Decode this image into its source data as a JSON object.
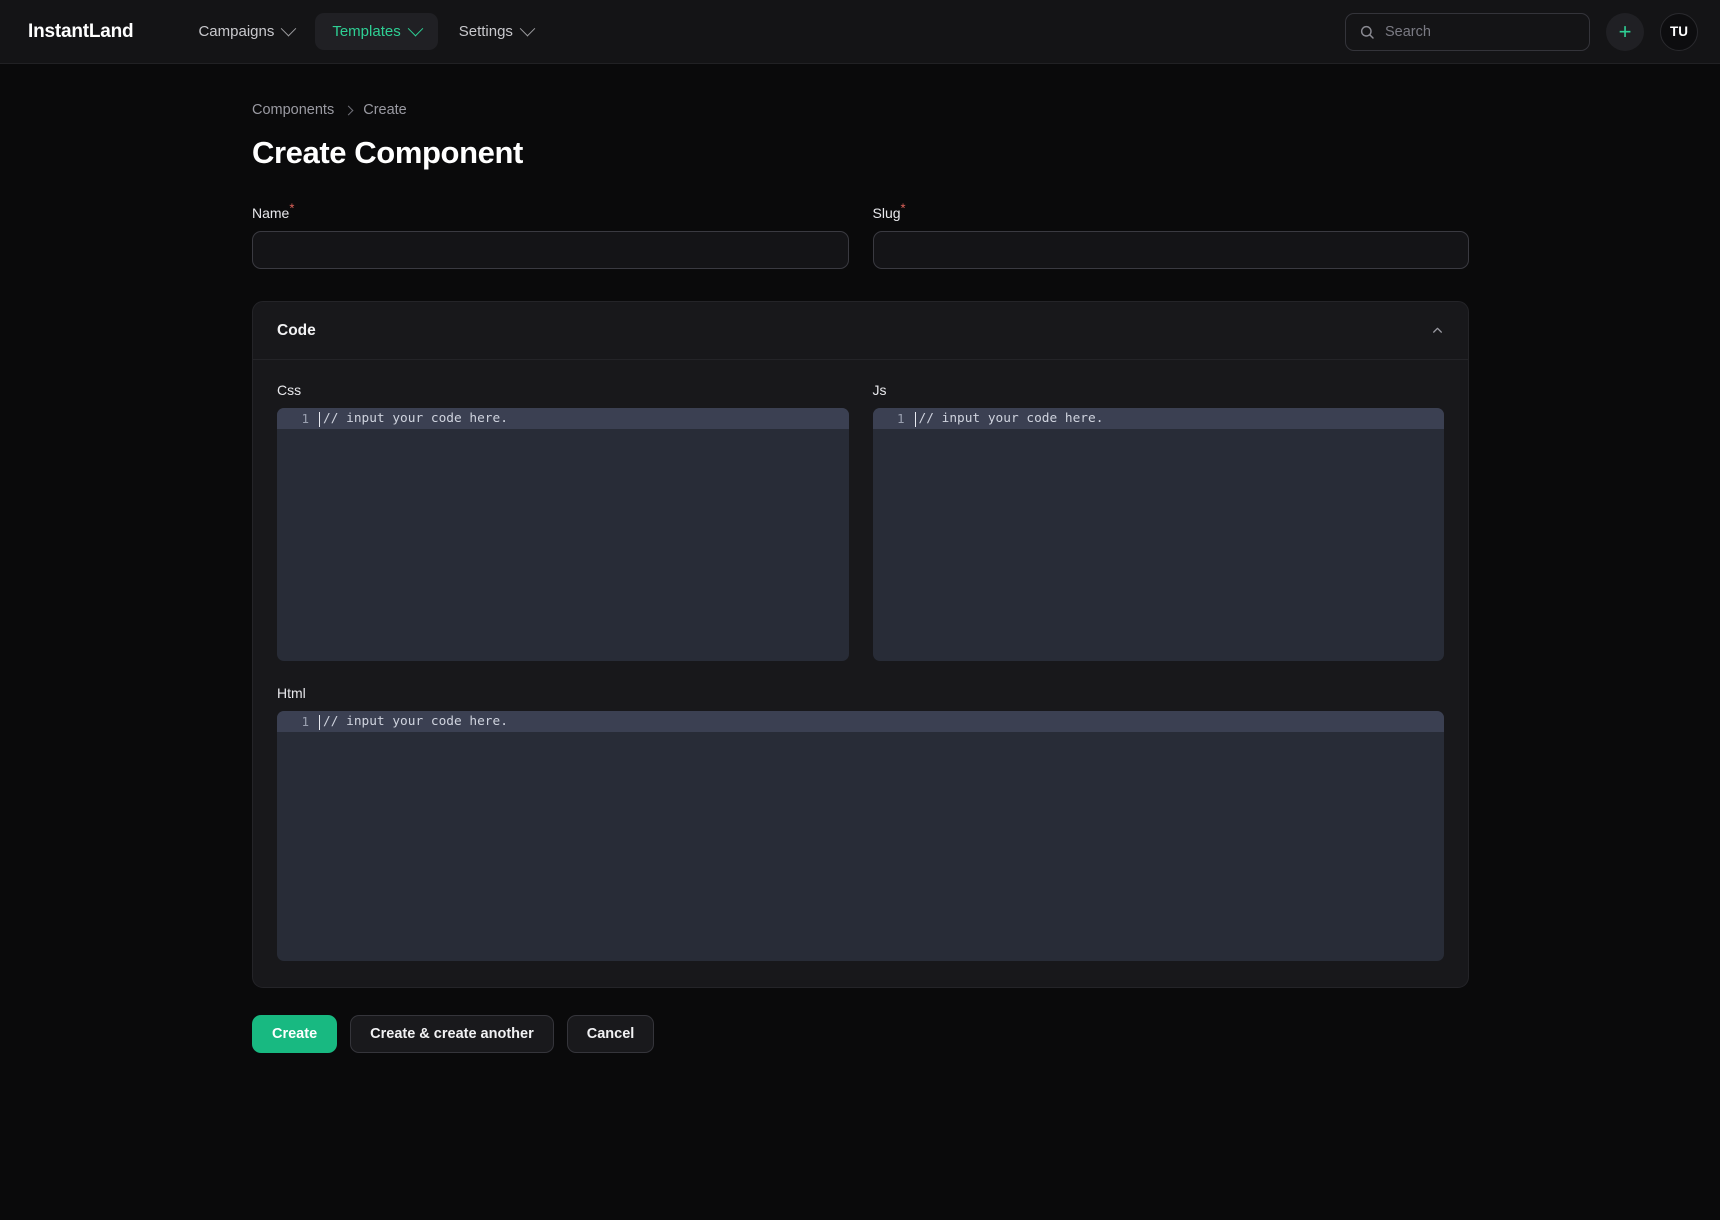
{
  "topbar": {
    "brand": "InstantLand",
    "nav": [
      {
        "label": "Campaigns",
        "active": false,
        "icon": "chevron-down-icon"
      },
      {
        "label": "Templates",
        "active": true,
        "icon": "chevron-down-icon"
      },
      {
        "label": "Settings",
        "active": false,
        "icon": "chevron-down-icon"
      }
    ],
    "search": {
      "placeholder": "Search",
      "value": "",
      "icon": "search-icon"
    },
    "add_button": {
      "label": "+",
      "icon": "plus-icon"
    },
    "avatar": {
      "initials": "TU"
    }
  },
  "breadcrumb": {
    "parent": "Components",
    "separator": "chevron-right-icon",
    "current": "Create"
  },
  "page": {
    "title": "Create Component"
  },
  "form": {
    "name": {
      "label": "Name",
      "required_marker": "*",
      "value": "",
      "placeholder": ""
    },
    "slug": {
      "label": "Slug",
      "required_marker": "*",
      "value": "",
      "placeholder": ""
    }
  },
  "code_section": {
    "title": "Code",
    "collapse_icon": "chevron-up-icon",
    "editors": [
      {
        "label": "Css",
        "line_number": "1",
        "placeholder": "// input your code here.",
        "value": ""
      },
      {
        "label": "Js",
        "line_number": "1",
        "placeholder": "// input your code here.",
        "value": ""
      },
      {
        "label": "Html",
        "line_number": "1",
        "placeholder": "// input your code here.",
        "value": ""
      }
    ]
  },
  "actions": {
    "create": "Create",
    "create_another": "Create & create another",
    "cancel": "Cancel"
  },
  "colors": {
    "accent_green": "#18b981",
    "nav_active_green": "#2ecf94",
    "required_red": "#e0635b",
    "page_bg": "#0a0a0b",
    "card_bg": "#18181b",
    "editor_bg": "#282c37",
    "editor_active_line": "#3b4052"
  }
}
